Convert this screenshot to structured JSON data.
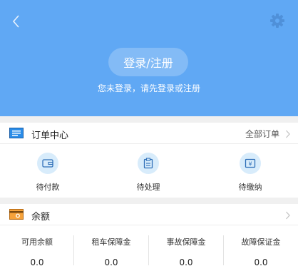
{
  "header": {
    "login_button": "登录/注册",
    "hint": "您未登录，请先登录或注册",
    "bg_color": "#60a8f4"
  },
  "orders": {
    "title": "订单中心",
    "more": "全部订单",
    "items": [
      {
        "label": "待付款",
        "icon": "wallet-icon"
      },
      {
        "label": "待处理",
        "icon": "clipboard-icon"
      },
      {
        "label": "待缴纳",
        "icon": "yen-card-icon"
      }
    ]
  },
  "balance": {
    "title": "余额",
    "columns": [
      {
        "label": "可用余额",
        "value": "0.0"
      },
      {
        "label": "租车保障金",
        "value": "0.0"
      },
      {
        "label": "事故保障金",
        "value": "0.0"
      },
      {
        "label": "故障保证金",
        "value": "0.0"
      }
    ]
  }
}
